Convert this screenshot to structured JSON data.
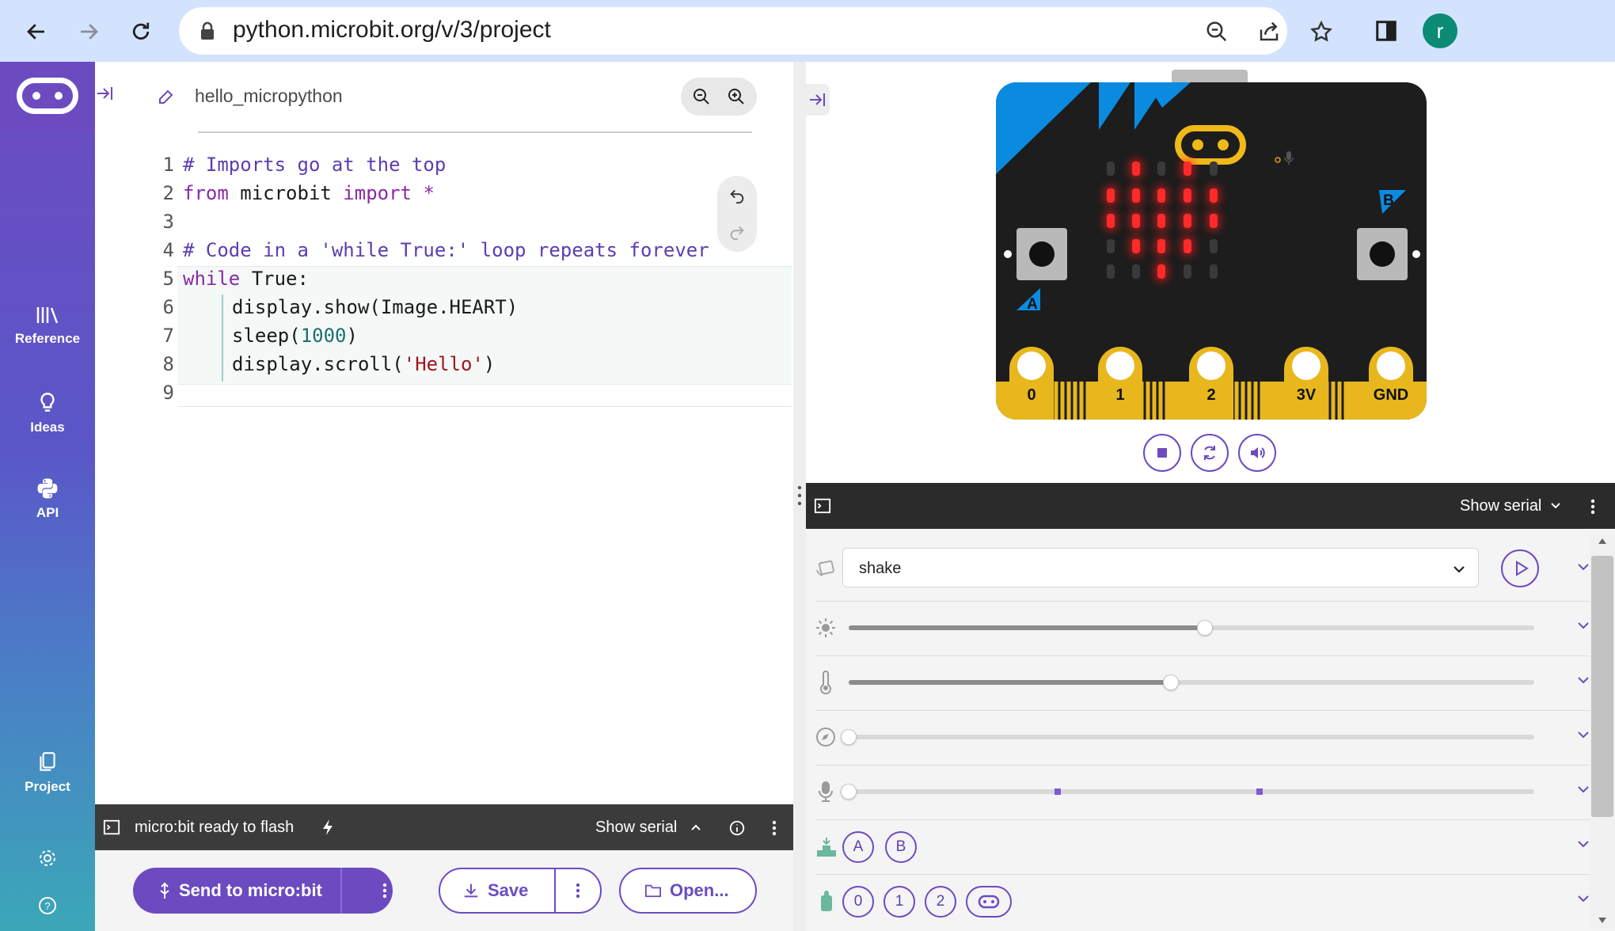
{
  "browser": {
    "url": "python.microbit.org/v/3/project",
    "avatar_letter": "r",
    "icons": [
      "back-arrow-icon",
      "forward-arrow-icon",
      "reload-icon",
      "lock-icon",
      "zoom-out-icon",
      "share-icon",
      "star-icon",
      "side-panel-icon"
    ]
  },
  "sidebar": {
    "items": [
      {
        "label": "Reference",
        "icon": "books-icon"
      },
      {
        "label": "Ideas",
        "icon": "lightbulb-icon"
      },
      {
        "label": "API",
        "icon": "python-icon"
      },
      {
        "label": "Project",
        "icon": "files-icon"
      }
    ],
    "bottom_icons": [
      "settings-icon",
      "help-icon"
    ]
  },
  "editor": {
    "project_name": "hello_micropython",
    "line_numbers": [
      "1",
      "2",
      "3",
      "4",
      "5",
      "6",
      "7",
      "8",
      "9"
    ],
    "code": {
      "l1": "# Imports go at the top",
      "l2_kw1": "from",
      "l2_mod": " microbit ",
      "l2_kw2": "import",
      "l2_star": " *",
      "l4": "# Code in a 'while True:' loop repeats forever",
      "l5_kw": "while",
      "l5_rest": " True:",
      "l6": "display.show(Image.HEART)",
      "l7_a": "sleep(",
      "l7_num": "1000",
      "l7_b": ")",
      "l8_a": "display.scroll(",
      "l8_str": "'Hello'",
      "l8_b": ")"
    }
  },
  "statusbar": {
    "message": "micro:bit ready to flash",
    "serial_toggle": "Show serial"
  },
  "actions": {
    "send": "Send to micro:bit",
    "save": "Save",
    "open": "Open..."
  },
  "simulator": {
    "button_a": "A",
    "button_b": "B",
    "pins": [
      "0",
      "1",
      "2",
      "3V",
      "GND"
    ],
    "led_grid": [
      [
        0,
        1,
        0,
        1,
        0
      ],
      [
        1,
        1,
        1,
        1,
        1
      ],
      [
        1,
        1,
        1,
        1,
        1
      ],
      [
        0,
        1,
        1,
        1,
        0
      ],
      [
        0,
        0,
        1,
        0,
        0
      ]
    ],
    "serial_toggle": "Show serial",
    "gesture_value": "shake",
    "light_level": 0.52,
    "temperature_level": 0.47,
    "compass_level": 0.0,
    "sound_level": 0.0,
    "sound_markers": [
      0.3,
      0.595
    ],
    "button_chips": [
      "A",
      "B"
    ],
    "pin_chips": [
      "0",
      "1",
      "2"
    ],
    "accent": "#6c4bc1"
  }
}
